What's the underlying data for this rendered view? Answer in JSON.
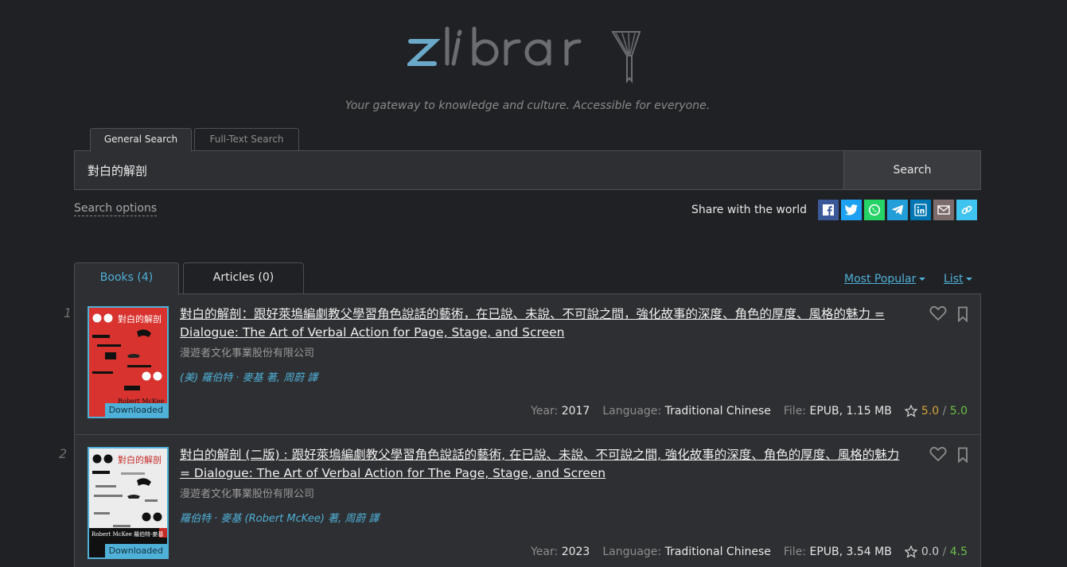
{
  "brand": {
    "logo": "zlibrary",
    "tagline": "Your gateway to knowledge and culture. Accessible for everyone."
  },
  "search": {
    "tabs": [
      "General Search",
      "Full-Text Search"
    ],
    "query": "對白的解剖",
    "button": "Search",
    "options_link": "Search options"
  },
  "share": {
    "label": "Share with the world",
    "icons": [
      "facebook-icon",
      "twitter-icon",
      "whatsapp-icon",
      "telegram-icon",
      "linkedin-icon",
      "email-icon",
      "link-icon"
    ]
  },
  "results_tabs": {
    "books": "Books (4)",
    "articles": "Articles  (0)"
  },
  "sorting": {
    "order": "Most Popular",
    "view": "List"
  },
  "labels": {
    "year": "Year:",
    "language": "Language:",
    "file": "File:",
    "downloaded": "Downloaded"
  },
  "books": [
    {
      "index": "1",
      "title": "對白的解剖：跟好萊塢編劇教父學習角色說話的藝術，在已說、未說、不可說之間，強化故事的深度、角色的厚度、風格的魅力 = Dialogue: The Art of Verbal Action for Page, Stage, and Screen",
      "publisher": "漫遊者文化事業股份有限公司",
      "authors": "(美) 羅伯特 · 麥基 著, 周蔚 譯",
      "year": "2017",
      "language": "Traditional Chinese",
      "file": "EPUB, 1.15 MB",
      "rating_user": "5.0",
      "rating_sep": "/",
      "rating_quality": "5.0",
      "cover_title": "對白的解剖",
      "cover_author": "Robert McKee"
    },
    {
      "index": "2",
      "title": "對白的解剖 (二版) : 跟好萊塢編劇教父學習角色說話的藝術, 在已說、未說、不可說之間, 強化故事的深度、角色的厚度、風格的魅力 = Dialogue: The Art of Verbal Action for The Page, Stage, and Screen",
      "publisher": "漫遊者文化事業股份有限公司",
      "authors": "羅伯特 · 麥基 (Robert McKee) 著, 周蔚 譯",
      "year": "2023",
      "language": "Traditional Chinese",
      "file": "EPUB, 3.54 MB",
      "rating_user": "0.0",
      "rating_sep": "/",
      "rating_quality": "4.5",
      "cover_title": "對白的解剖",
      "cover_author": "Robert McKee 羅伯特·麥基"
    }
  ],
  "colors": {
    "accent": "#4fb0d8",
    "background": "#202124",
    "panel": "#2e2f32",
    "rating_gold": "#d4a43a",
    "rating_green": "#6bbf48"
  }
}
